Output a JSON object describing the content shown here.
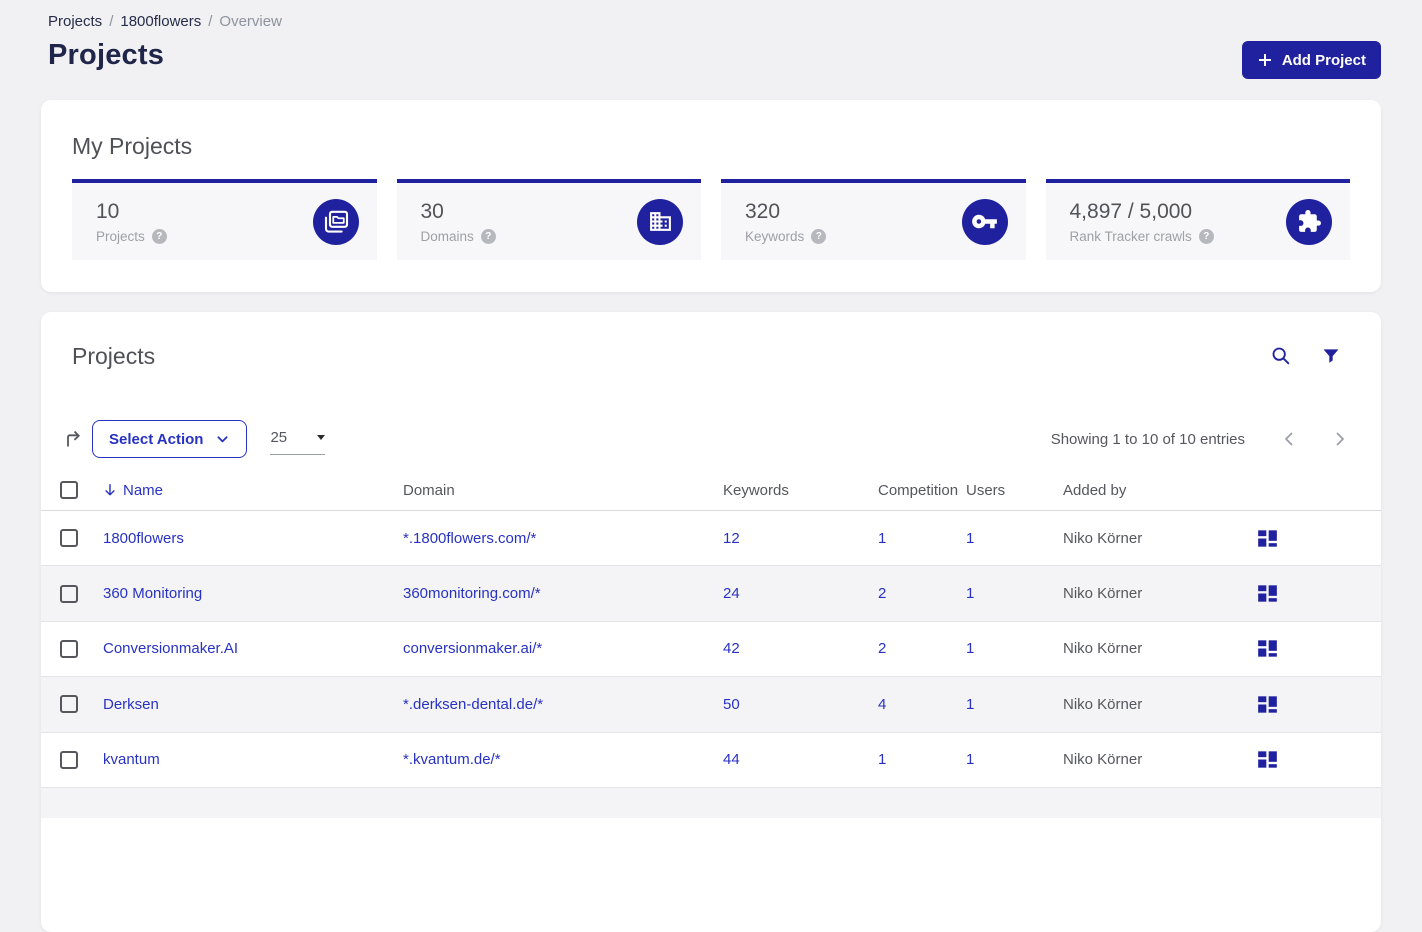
{
  "colors": {
    "brand": "#20219f",
    "link": "#2832c2",
    "page_bg": "#f1f1f3"
  },
  "breadcrumb": {
    "separator": "/",
    "items": [
      {
        "label": "Projects"
      },
      {
        "label": "1800flowers"
      },
      {
        "label": "Overview"
      }
    ]
  },
  "header": {
    "title": "Projects",
    "add_button_label": "Add Project"
  },
  "stats": {
    "title": "My Projects",
    "tiles": [
      {
        "value": "10",
        "label": "Projects",
        "icon": "projects-stack-icon"
      },
      {
        "value": "30",
        "label": "Domains",
        "icon": "building-icon"
      },
      {
        "value": "320",
        "label": "Keywords",
        "icon": "key-icon"
      },
      {
        "value": "4,897 / 5,000",
        "label": "Rank Tracker crawls",
        "icon": "puzzle-icon"
      }
    ]
  },
  "table": {
    "title": "Projects",
    "select_action_label": "Select Action",
    "page_size": "25",
    "showing_text": "Showing 1 to 10 of 10 entries",
    "columns": [
      "Name",
      "Domain",
      "Keywords",
      "Competition",
      "Users",
      "Added by"
    ],
    "rows": [
      {
        "name": "1800flowers",
        "domain": "*.1800flowers.com/*",
        "keywords": "12",
        "competition": "1",
        "users": "1",
        "added_by": "Niko Körner"
      },
      {
        "name": "360 Monitoring",
        "domain": "360monitoring.com/*",
        "keywords": "24",
        "competition": "2",
        "users": "1",
        "added_by": "Niko Körner"
      },
      {
        "name": "Conversionmaker.AI",
        "domain": "conversionmaker.ai/*",
        "keywords": "42",
        "competition": "2",
        "users": "1",
        "added_by": "Niko Körner"
      },
      {
        "name": "Derksen",
        "domain": "*.derksen-dental.de/*",
        "keywords": "50",
        "competition": "4",
        "users": "1",
        "added_by": "Niko Körner"
      },
      {
        "name": "kvantum",
        "domain": "*.kvantum.de/*",
        "keywords": "44",
        "competition": "1",
        "users": "1",
        "added_by": "Niko Körner"
      }
    ]
  }
}
